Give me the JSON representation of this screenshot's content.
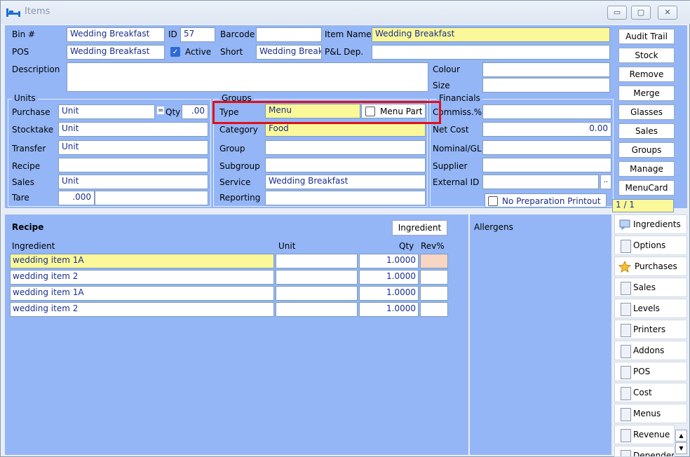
{
  "window": {
    "title": "Items",
    "buttons": [
      "▭",
      "▢",
      "✕"
    ]
  },
  "header": {
    "bin_label": "Bin #",
    "bin_value": "Wedding Breakfast",
    "id_label": "ID",
    "id_value": "57",
    "barcode_label": "Barcode",
    "barcode_value": "",
    "item_name_label": "Item Name",
    "item_name_value": "Wedding Breakfast",
    "pos_label": "POS",
    "pos_value": "Wedding Breakfast",
    "active_label": "Active",
    "active_checked": true,
    "short_label": "Short",
    "short_value": "Wedding Break",
    "pl_dep_label": "P&L Dep.",
    "pl_dep_value": "",
    "description_label": "Description",
    "description_value": "",
    "colour_label": "Colour",
    "colour_value": "",
    "size_label": "Size",
    "size_value": ""
  },
  "units": {
    "title": "Units",
    "purchase_label": "Purchase",
    "purchase_value": "Unit",
    "eq": "=",
    "qty_label": "Qty",
    "qty_value": ".00",
    "stocktake_label": "Stocktake",
    "stocktake_value": "Unit",
    "transfer_label": "Transfer",
    "transfer_value": "Unit",
    "recipe_label": "Recipe",
    "recipe_value": "",
    "sales_label": "Sales",
    "sales_value": "Unit",
    "tare_label": "Tare",
    "tare_value": ".000"
  },
  "groups": {
    "title": "Groups",
    "type_label": "Type",
    "type_value": "Menu",
    "menu_part_label": "Menu Part",
    "category_label": "Category",
    "category_value": "Food",
    "group_label": "Group",
    "group_value": "",
    "subgroup_label": "Subgroup",
    "subgroup_value": "",
    "service_label": "Service",
    "service_value": "Wedding Breakfast",
    "reporting_label": "Reporting",
    "reporting_value": ""
  },
  "financials": {
    "title": "Financials",
    "commiss_label": "Commiss.%",
    "commiss_value": "",
    "net_cost_label": "Net Cost",
    "net_cost_value": "0.00",
    "nominal_label": "Nominal/GL",
    "nominal_value": "",
    "supplier_label": "Supplier",
    "supplier_value": "",
    "external_id_label": "External ID",
    "external_id_value": "",
    "ellipsis": "..",
    "no_prep_label": "No Preparation Printout"
  },
  "side_buttons": [
    "Audit Trail",
    "Stock",
    "Remove",
    "Merge",
    "Glasses",
    "Sales",
    "Groups",
    "Manage",
    "MenuCard"
  ],
  "record_nav": "1 / 1",
  "recipe": {
    "title": "Recipe",
    "ingredient_button": "Ingredient",
    "columns": {
      "ingredient": "Ingredient",
      "unit": "Unit",
      "qty": "Qty",
      "rev": "Rev%"
    },
    "rows": [
      {
        "ingredient": "wedding item 1A",
        "unit": "",
        "qty": "1.0000",
        "rev": ""
      },
      {
        "ingredient": "wedding item 2",
        "unit": "",
        "qty": "1.0000",
        "rev": ""
      },
      {
        "ingredient": "wedding item 1A",
        "unit": "",
        "qty": "1.0000",
        "rev": ""
      },
      {
        "ingredient": "wedding item 2",
        "unit": "",
        "qty": "1.0000",
        "rev": ""
      }
    ]
  },
  "allergens": {
    "title": "Allergens"
  },
  "tabs": [
    "Ingredients",
    "Options",
    "Purchases",
    "Sales",
    "Levels",
    "Printers",
    "Addons",
    "POS",
    "Cost",
    "Menus",
    "Revenue",
    "Dependen"
  ],
  "colors": {
    "panel": "#94b6f7",
    "highlight": "#fbf89a",
    "annotation": "#e0101a"
  }
}
